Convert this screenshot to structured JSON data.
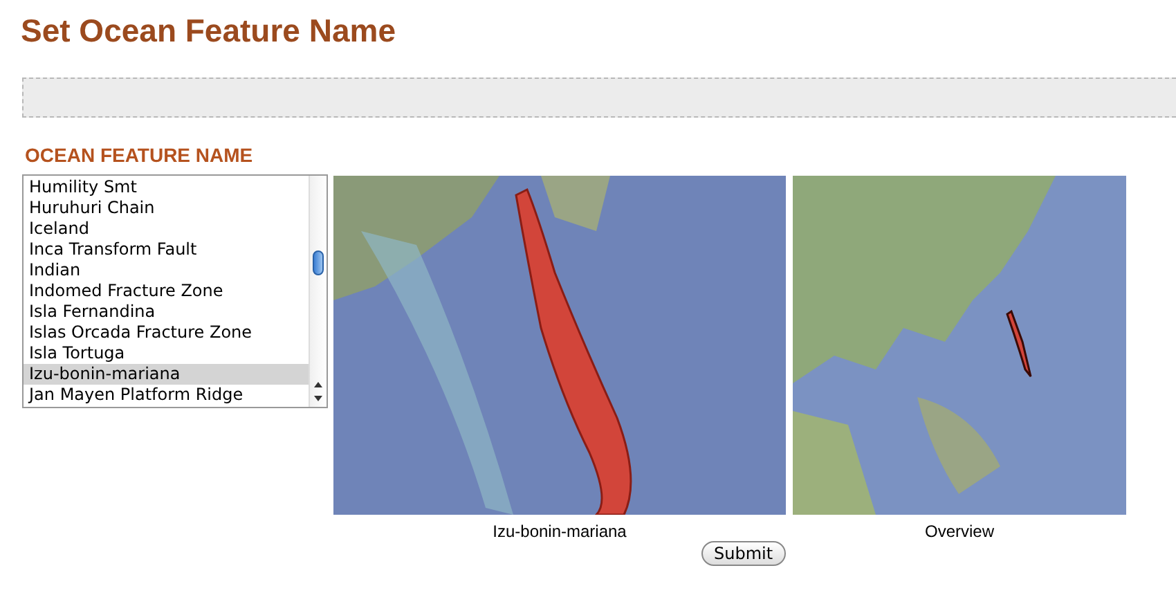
{
  "title": "Set Ocean Feature Name",
  "section_heading": "OCEAN FEATURE NAME",
  "feature_list": [
    {
      "label": "Humility Smt",
      "selected": false
    },
    {
      "label": "Huruhuri Chain",
      "selected": false
    },
    {
      "label": "Iceland",
      "selected": false
    },
    {
      "label": "Inca Transform Fault",
      "selected": false
    },
    {
      "label": "Indian",
      "selected": false
    },
    {
      "label": "Indomed Fracture Zone",
      "selected": false
    },
    {
      "label": "Isla Fernandina",
      "selected": false
    },
    {
      "label": "Islas Orcada Fracture Zone",
      "selected": false
    },
    {
      "label": "Isla Tortuga",
      "selected": false
    },
    {
      "label": "Izu-bonin-mariana",
      "selected": true
    },
    {
      "label": "Jan Mayen Platform Ridge",
      "selected": false
    }
  ],
  "maps": [
    {
      "kind": "detail",
      "caption": "Izu-bonin-mariana"
    },
    {
      "kind": "overview",
      "caption": "Overview"
    }
  ],
  "submit_button": "Submit"
}
